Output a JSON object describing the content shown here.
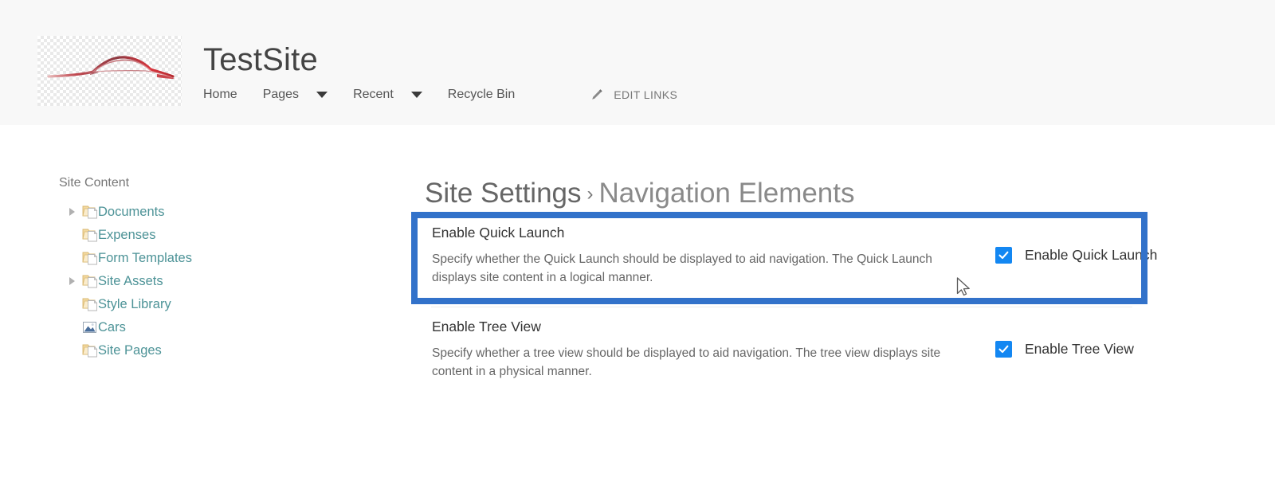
{
  "header": {
    "site_title": "TestSite",
    "logo_alt": "car-logo",
    "nav": [
      {
        "label": "Home",
        "has_caret": false
      },
      {
        "label": "Pages",
        "has_caret": true
      },
      {
        "label": "Recent",
        "has_caret": true
      },
      {
        "label": "Recycle Bin",
        "has_caret": false
      }
    ],
    "edit_links_label": "EDIT LINKS"
  },
  "sidebar": {
    "title": "Site Content",
    "items": [
      {
        "label": "Documents",
        "expandable": true,
        "icon": "folder-document-icon"
      },
      {
        "label": "Expenses",
        "expandable": false,
        "icon": "folder-document-icon"
      },
      {
        "label": "Form Templates",
        "expandable": false,
        "icon": "folder-document-icon"
      },
      {
        "label": "Site Assets",
        "expandable": true,
        "icon": "folder-document-icon"
      },
      {
        "label": "Style Library",
        "expandable": false,
        "icon": "folder-document-icon"
      },
      {
        "label": "Cars",
        "expandable": false,
        "icon": "picture-library-icon"
      },
      {
        "label": "Site Pages",
        "expandable": false,
        "icon": "folder-document-icon"
      }
    ]
  },
  "main": {
    "breadcrumb_parent": "Site Settings",
    "breadcrumb_separator": "›",
    "breadcrumb_current": "Navigation Elements",
    "settings": [
      {
        "title": "Enable Quick Launch",
        "description": "Specify whether the Quick Launch should be displayed to aid navigation.  The Quick Launch displays site content in a logical manner.",
        "checkbox_label": "Enable Quick Launch",
        "checked": true
      },
      {
        "title": "Enable Tree View",
        "description": "Specify whether a tree view should be displayed to aid navigation.  The tree view displays site content in a physical manner.",
        "checkbox_label": "Enable Tree View",
        "checked": true
      }
    ]
  },
  "colors": {
    "highlight_border": "#3272ca",
    "checkbox_fill": "#1387f2",
    "tree_link": "#4d9397",
    "header_band": "#f8f8f8"
  }
}
